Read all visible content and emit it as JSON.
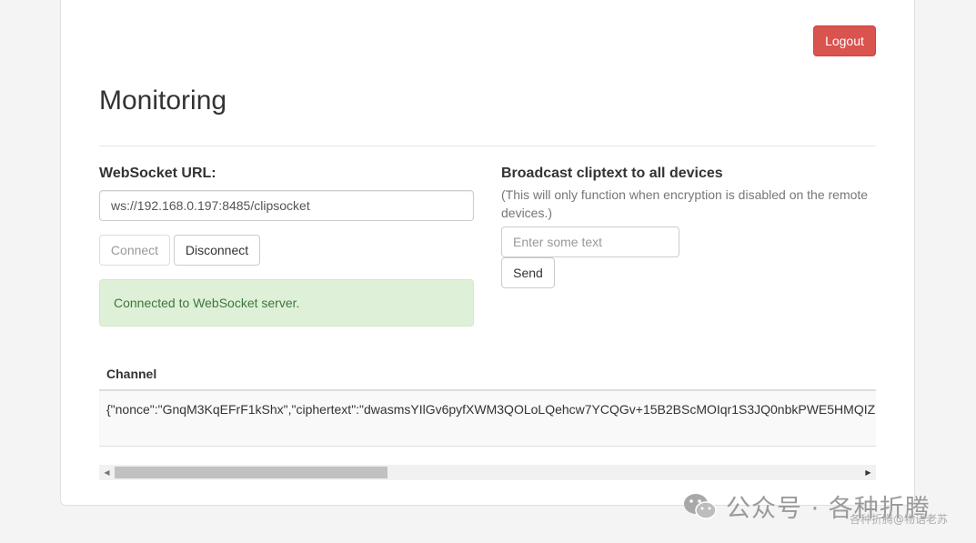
{
  "header": {
    "logout_label": "Logout",
    "title": "Monitoring"
  },
  "websocket": {
    "label": "WebSocket URL:",
    "url_value": "ws://192.168.0.197:8485/clipsocket",
    "connect_label": "Connect",
    "disconnect_label": "Disconnect",
    "status_message": "Connected to WebSocket server."
  },
  "broadcast": {
    "title": "Broadcast cliptext to all devices",
    "note": "(This will only function when encryption is disabled on the remote devices.)",
    "input_placeholder": "Enter some text",
    "send_label": "Send"
  },
  "table": {
    "column_header": "Channel",
    "rows": [
      "{\"nonce\":\"GnqM3KqEFrF1kShx\",\"ciphertext\":\"dwasmsYIlGv6pyfXWM3QOLoLQehcw7YCQGv+15B2BScMOIqr1S3JQ0nbkPWE5HMQIZ"
    ]
  },
  "watermark": {
    "text": "公众号 · 各种折腾",
    "sub": "各种折腾@物语老苏"
  },
  "colors": {
    "danger": "#d9534f",
    "success_bg": "#dff0d8",
    "success_text": "#3c763d"
  }
}
